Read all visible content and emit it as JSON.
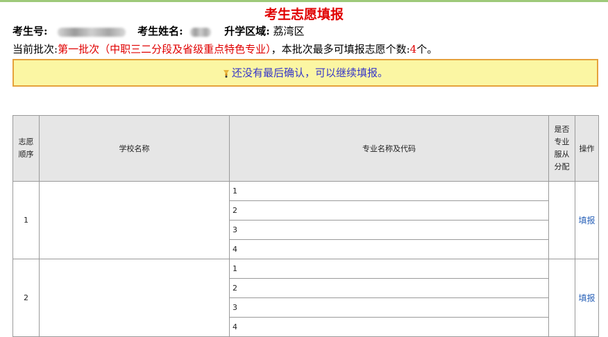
{
  "page": {
    "title": "考生志愿填报"
  },
  "candidate": {
    "id_label": "考生号:",
    "name_label": "考生姓名:",
    "district_label": "升学区域:",
    "district": "荔湾区"
  },
  "batch": {
    "prefix": "当前批次:",
    "name": "第一批次（中职三二分段及省级重点特色专业）",
    "middle": "，本批次最多可填报志愿个数:",
    "max": "4",
    "suffix": "个。"
  },
  "notice": {
    "icon": "lightbulb-icon",
    "text": "还没有最后确认，可以继续填报。"
  },
  "table": {
    "headers": {
      "order": [
        "志愿",
        "顺序"
      ],
      "school": "学校名称",
      "major": "专业名称及代码",
      "obey": [
        "是否",
        "专业",
        "服从",
        "分配"
      ],
      "action": "操作"
    },
    "rows": [
      {
        "index": "1",
        "school": "",
        "majors": [
          "1",
          "2",
          "3",
          "4"
        ],
        "action": "填报"
      },
      {
        "index": "2",
        "school": "",
        "majors": [
          "1",
          "2",
          "3",
          "4"
        ],
        "action": "填报"
      }
    ]
  },
  "colors": {
    "title": "#e00000",
    "notice_bg": "#fbf6a3",
    "notice_border": "#e6a23c",
    "notice_text": "#3636c8",
    "link": "#2a62b8"
  }
}
